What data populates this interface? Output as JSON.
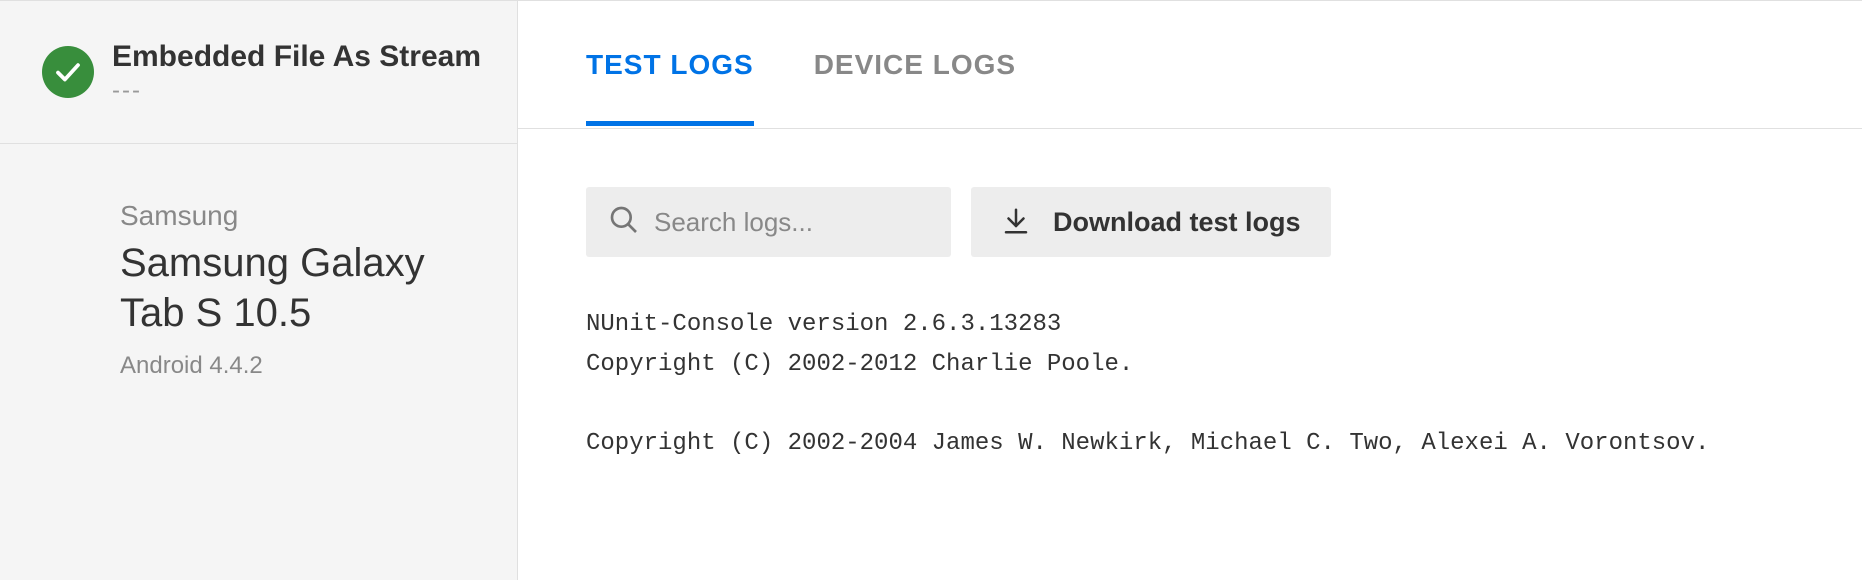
{
  "sidebar": {
    "test_title": "Embedded File As Stream",
    "dashes": "---",
    "device": {
      "manufacturer": "Samsung",
      "name": "Samsung Galaxy Tab S 10.5",
      "os": "Android 4.4.2"
    }
  },
  "tabs": {
    "test_logs": "TEST LOGS",
    "device_logs": "DEVICE LOGS"
  },
  "controls": {
    "search_placeholder": "Search logs...",
    "download_label": "Download test logs"
  },
  "logs": "NUnit-Console version 2.6.3.13283\nCopyright (C) 2002-2012 Charlie Poole.\n\nCopyright (C) 2002-2004 James W. Newkirk, Michael C. Two, Alexei A. Vorontsov."
}
